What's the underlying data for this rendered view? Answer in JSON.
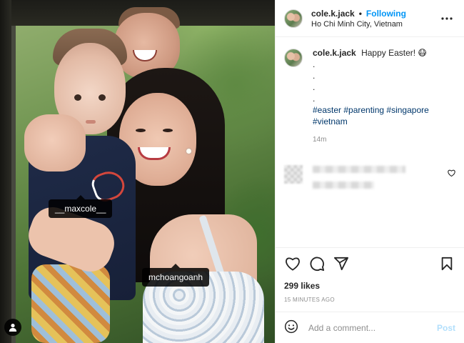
{
  "post": {
    "author": {
      "username": "cole.k.jack",
      "follow_status": "Following",
      "separator": "•",
      "location": "Ho Chi Minh City, Vietnam"
    },
    "caption": {
      "username": "cole.k.jack",
      "text": "Happy Easter! 😷",
      "dot_lines": [
        ".",
        ".",
        ".",
        "."
      ],
      "hashtags": "#easter #parenting #singapore #vietnam",
      "time": "14m"
    },
    "photo_tags": [
      {
        "label": "__maxcole__"
      },
      {
        "label": "mchoangoanh"
      }
    ],
    "likes": "299 likes",
    "time_ago": "15 MINUTES AGO",
    "comment_box": {
      "placeholder": "Add a comment...",
      "post_label": "Post"
    },
    "icons": {
      "more": "more-options-icon",
      "like": "heart-icon",
      "comment": "comment-icon",
      "share": "send-icon",
      "save": "bookmark-icon",
      "emoji": "emoji-icon",
      "user_tags": "user-tag-icon"
    },
    "colors": {
      "follow": "#0095f6",
      "hashtag": "#00376b",
      "post_disabled": "#b2dffc",
      "muted": "#8e8e8e"
    }
  }
}
